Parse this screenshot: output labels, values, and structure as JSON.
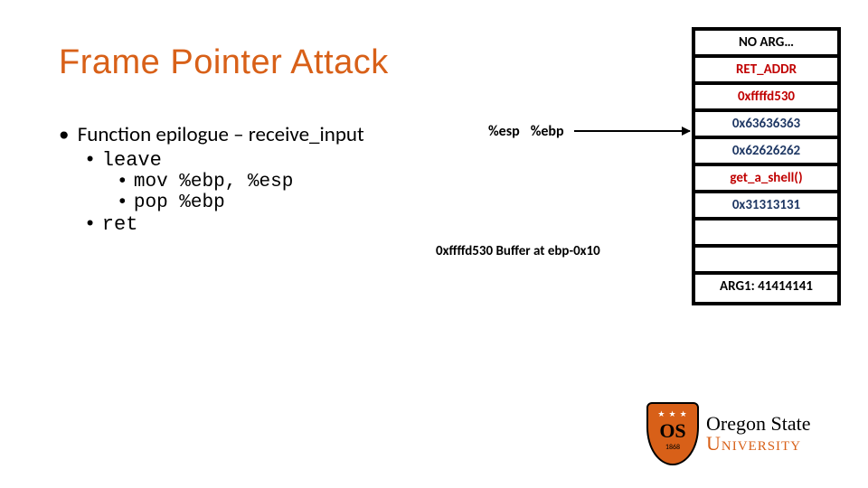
{
  "title": "Frame Pointer Attack",
  "bullets": {
    "lvl1": "Function epilogue – receive_input",
    "lvl2a": "leave",
    "lvl3a": "mov %ebp, %esp",
    "lvl3b": "pop %ebp",
    "lvl2b": "ret"
  },
  "registers": {
    "esp": "%esp",
    "ebp": "%ebp"
  },
  "buffer_label": "0xffffd530  Buffer at ebp-0x10",
  "stack": [
    {
      "text": "NO ARG…",
      "cls": "",
      "name": "stack-cell-no-arg"
    },
    {
      "text": "RET_ADDR",
      "cls": "red",
      "name": "stack-cell-ret-addr"
    },
    {
      "text": "0xffffd530",
      "cls": "red",
      "name": "stack-cell-saved-ebp"
    },
    {
      "text": "0x63636363",
      "cls": "blue",
      "name": "stack-cell-buf3"
    },
    {
      "text": "0x62626262",
      "cls": "blue",
      "name": "stack-cell-buf2"
    },
    {
      "text": "get_a_shell()",
      "cls": "red",
      "name": "stack-cell-get-a-shell"
    },
    {
      "text": "0x31313131",
      "cls": "blue",
      "name": "stack-cell-buf0"
    },
    {
      "text": "",
      "cls": "",
      "name": "stack-cell-empty1"
    },
    {
      "text": "",
      "cls": "",
      "name": "stack-cell-empty2"
    },
    {
      "text": "ARG1: 41414141",
      "cls": "",
      "name": "stack-cell-arg1"
    }
  ],
  "logo": {
    "line1": "Oregon State",
    "line2": "University"
  }
}
